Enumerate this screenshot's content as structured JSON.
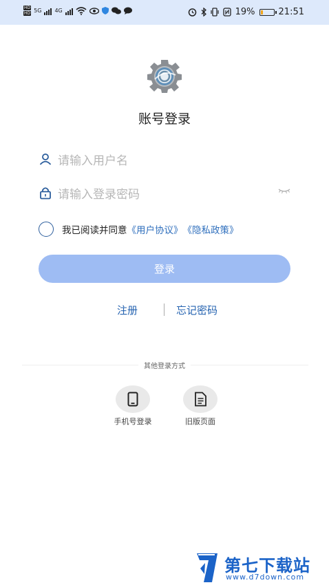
{
  "status_bar": {
    "hd_labels": [
      "HD",
      "HD"
    ],
    "net_5g": "5G",
    "net_4g": "4G",
    "battery_percent": "19%",
    "battery_level": 0.19,
    "time": "21:51"
  },
  "login": {
    "title": "账号登录",
    "username_placeholder": "请输入用户名",
    "password_placeholder": "请输入登录密码",
    "agree_text": "我已阅读并同意",
    "user_agreement": "《用户协议》",
    "privacy_policy": "《隐私政策》",
    "login_button": "登录",
    "register": "注册",
    "forgot_password": "忘记密码"
  },
  "other_login": {
    "title": "其他登录方式",
    "options": [
      {
        "label": "手机号登录",
        "icon": "phone-icon"
      },
      {
        "label": "旧版页面",
        "icon": "document-icon"
      }
    ]
  },
  "watermark": {
    "title": "第七下载站",
    "url": "www.d7down.com"
  },
  "colors": {
    "statusbar_bg": "#dde9fb",
    "button_bg": "#9ebcf3",
    "link": "#2f6fbd",
    "icon_blue": "#2b5d9c"
  }
}
